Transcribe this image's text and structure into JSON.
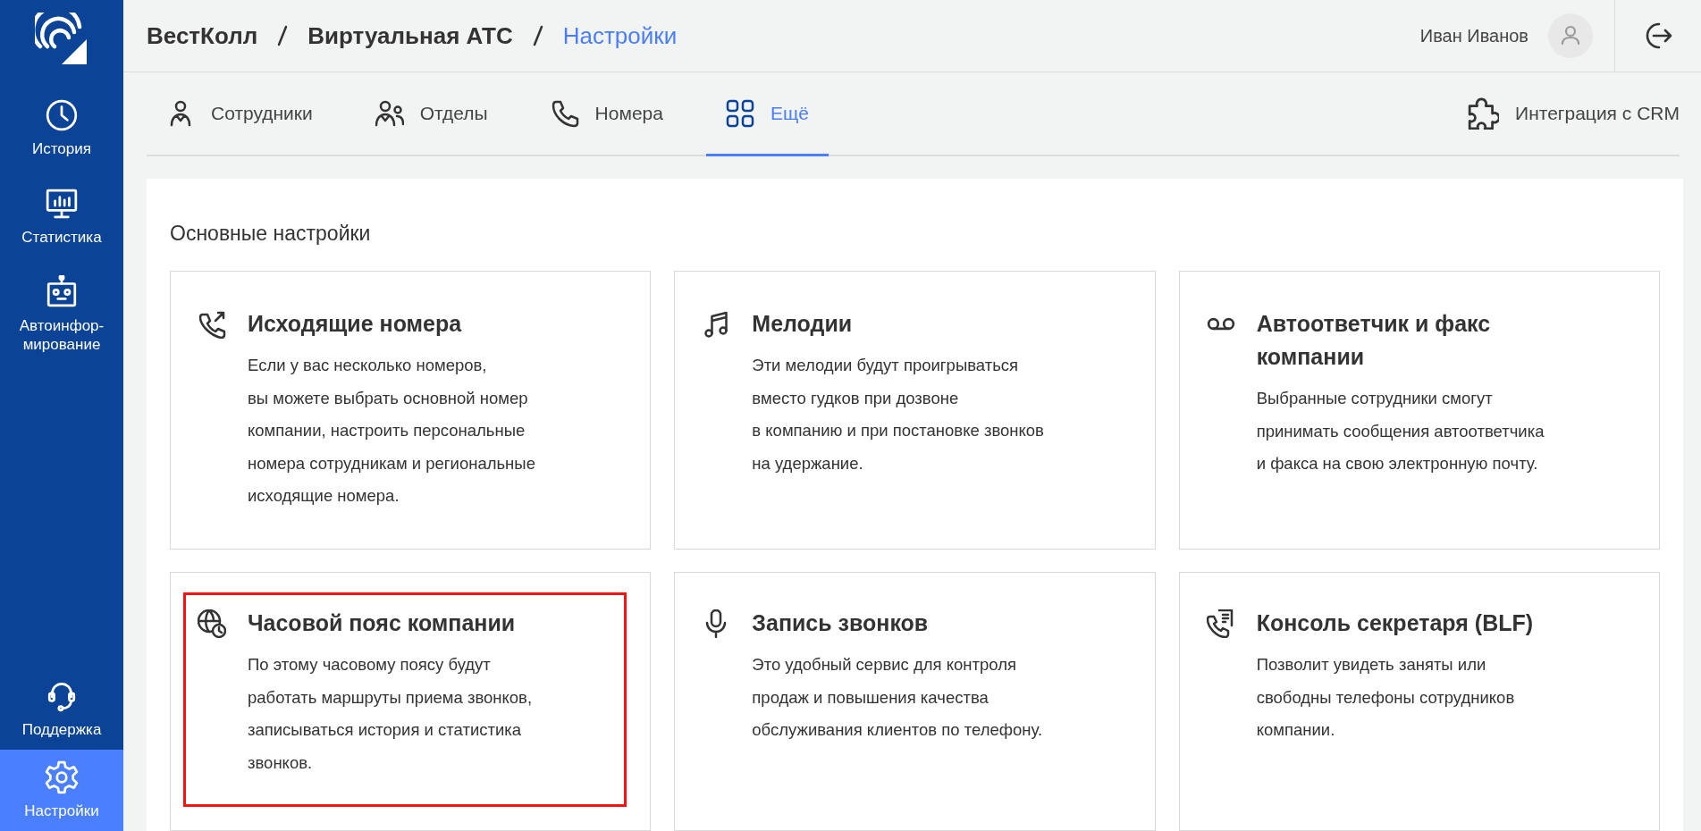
{
  "sidebar": {
    "items": [
      {
        "kind": "clock",
        "label": "История",
        "selected": false
      },
      {
        "kind": "chart",
        "label": "Статистика",
        "selected": false
      },
      {
        "kind": "robot",
        "label": "Автоинфор-\nмирование",
        "selected": false
      }
    ],
    "bottom_items": [
      {
        "kind": "headset",
        "label": "Поддержка",
        "selected": false
      },
      {
        "kind": "gear",
        "label": "Настройки",
        "selected": true
      }
    ]
  },
  "breadcrumb": [
    {
      "label": "ВестКолл",
      "current": false
    },
    {
      "label": "Виртуальная АТС",
      "current": false
    },
    {
      "label": "Настройки",
      "current": true
    }
  ],
  "user": {
    "name": "Иван Иванов"
  },
  "tabs": [
    {
      "kind": "person",
      "label": "Сотрудники",
      "selected": false
    },
    {
      "kind": "people",
      "label": "Отделы",
      "selected": false
    },
    {
      "kind": "phone",
      "label": "Номера",
      "selected": false
    },
    {
      "kind": "grid",
      "label": "Ещё",
      "selected": true
    }
  ],
  "crm_link": {
    "label": "Интеграция с CRM"
  },
  "section": {
    "title": "Основные настройки",
    "cards": [
      {
        "kind": "outgoing",
        "title": "Исходящие номера",
        "description": "Если у вас несколько номеров,\nвы можете выбрать основной номер\nкомпании, настроить персональные\nномера сотрудникам и региональные\nисходящие номера.",
        "highlighted": false
      },
      {
        "kind": "music",
        "title": "Мелодии",
        "description": "Эти мелодии будут проигрываться\nвместо гудков при дозвоне\nв компанию и при постановке звонков\nна удержание.",
        "highlighted": false
      },
      {
        "kind": "voicemail",
        "title": "Автоответчик и факс\nкомпании",
        "description": "Выбранные сотрудники смогут\nпринимать сообщения автоответчика\nи факса на свою электронную почту.",
        "highlighted": false
      },
      {
        "kind": "timezone",
        "title": "Часовой пояс компании",
        "description": "По этому часовому поясу будут\nработать маршруты приема звонков,\nзаписываться история и статистика\nзвонков.",
        "highlighted": true
      },
      {
        "kind": "mic",
        "title": "Запись звонков",
        "description": "Это удобный сервис для контроля\nпродаж и повышения качества\nобслуживания клиентов по телефону.",
        "highlighted": false
      },
      {
        "kind": "blf",
        "title": "Консоль секретаря (BLF)",
        "description": "Позволит увидеть заняты или\nсвободны телефоны сотрудников\nкомпании.",
        "highlighted": false
      }
    ]
  }
}
